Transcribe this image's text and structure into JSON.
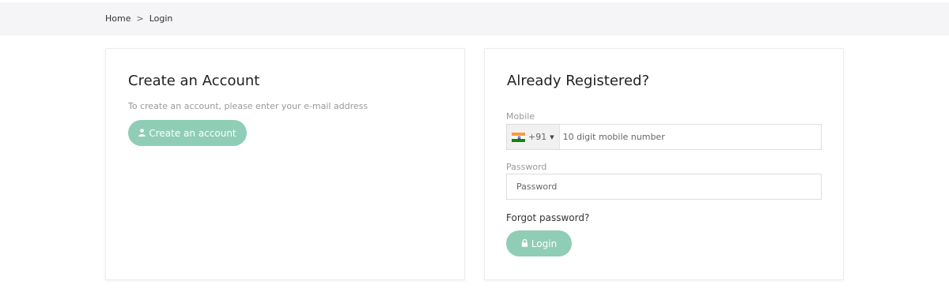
{
  "breadcrumb": {
    "home": "Home",
    "separator": ">",
    "current": "Login"
  },
  "create_account": {
    "title": "Create an Account",
    "description": "To create an account, please enter your e-mail address",
    "button_label": "Create an account",
    "button_icon": "user-icon"
  },
  "login": {
    "title": "Already Registered?",
    "mobile_label": "Mobile",
    "country_code": "+91",
    "country_flag": "india-flag-icon",
    "mobile_placeholder": "10 digit mobile number",
    "password_label": "Password",
    "password_placeholder": "Password",
    "forgot_label": "Forgot password?",
    "button_label": "Login",
    "button_icon": "lock-icon"
  },
  "colors": {
    "accent": "#8fcdb6",
    "breadcrumb_bg": "#f5f5f7"
  }
}
